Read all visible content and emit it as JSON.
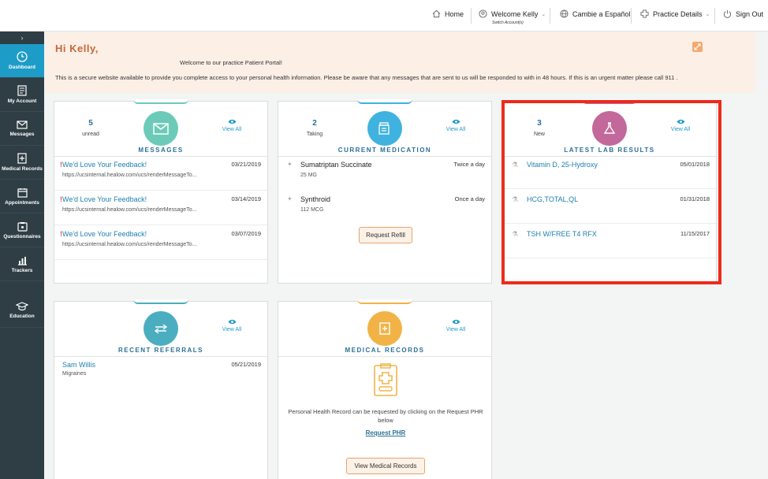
{
  "topbar": {
    "home": "Home",
    "welcome": "Welcome Kelly",
    "switch_account": "Switch Account(s)",
    "language": "Cambie a Español",
    "practice": "Practice Details",
    "signout": "Sign Out"
  },
  "sidebar": {
    "items": [
      {
        "label": "Dashboard",
        "icon": "clock-icon"
      },
      {
        "label": "My Account",
        "icon": "document-icon"
      },
      {
        "label": "Messages",
        "icon": "envelope-icon"
      },
      {
        "label": "Medical Records",
        "icon": "plus-folder-icon"
      },
      {
        "label": "Appointments",
        "icon": "calendar-icon"
      },
      {
        "label": "Questionnaires",
        "icon": "clipboard-icon"
      },
      {
        "label": "Trackers",
        "icon": "bar-chart-icon"
      },
      {
        "label": "Education",
        "icon": "graduation-cap-icon"
      }
    ]
  },
  "banner": {
    "greeting": "Hi Kelly,",
    "welcome": "Welcome to our practice Patient Portal!",
    "info": "This is a secure website available to provide you complete access to your personal health information. Please be aware that any messages that are sent to us will  be responded to with in 48 hours. If this is an urgent matter please call 911 ."
  },
  "messages": {
    "count": "5",
    "count_label": "unread",
    "title": "MESSAGES",
    "view_all": "View All",
    "items": [
      {
        "title": "We'd Love Your Feedback!",
        "sub": "https://ucsinternal.healow.com/ucs/renderMessageTo...",
        "date": "03/21/2019"
      },
      {
        "title": "We'd Love Your Feedback!",
        "sub": "https://ucsinternal.healow.com/ucs/renderMessageTo...",
        "date": "03/14/2019"
      },
      {
        "title": "We'd Love Your Feedback!",
        "sub": "https://ucsinternal.healow.com/ucs/renderMessageTo...",
        "date": "03/07/2019"
      }
    ]
  },
  "medication": {
    "count": "2",
    "count_label": "Taking",
    "title": "CURRENT MEDICATION",
    "view_all": "View All",
    "items": [
      {
        "name": "Sumatriptan Succinate",
        "dose": "25 MG",
        "freq": "Twice a day"
      },
      {
        "name": "Synthroid",
        "dose": "112 MCG",
        "freq": "Once a day"
      }
    ],
    "refill": "Request Refill"
  },
  "labs": {
    "count": "3",
    "count_label": "New",
    "title": "LATEST LAB RESULTS",
    "view_all": "View All",
    "items": [
      {
        "name": "Vitamin D, 25-Hydroxy",
        "date": "05/01/2018"
      },
      {
        "name": "HCG,TOTAL,QL",
        "date": "01/31/2018"
      },
      {
        "name": "TSH W/FREE T4 RFX",
        "date": "11/15/2017"
      }
    ]
  },
  "referrals": {
    "title": "RECENT REFERRALS",
    "view_all": "View All",
    "items": [
      {
        "name": "Sam Willis",
        "sub": "Migraines",
        "date": "05/21/2019"
      }
    ]
  },
  "records": {
    "title": "MEDICAL RECORDS",
    "view_all": "View All",
    "text": "Personal Health Record can be requested by clicking on the Request PHR below",
    "request": "Request PHR",
    "view_button": "View Medical Records"
  },
  "colors": {
    "sidebar": "#2f3d45",
    "active": "#1e9cc8",
    "messages_circle": "#6ccbb8",
    "medication_circle": "#3fb2e0",
    "labs_circle": "#c2689a",
    "referrals_circle": "#4aaec0",
    "records_circle": "#f2b346",
    "highlight": "#ef2a1a"
  }
}
